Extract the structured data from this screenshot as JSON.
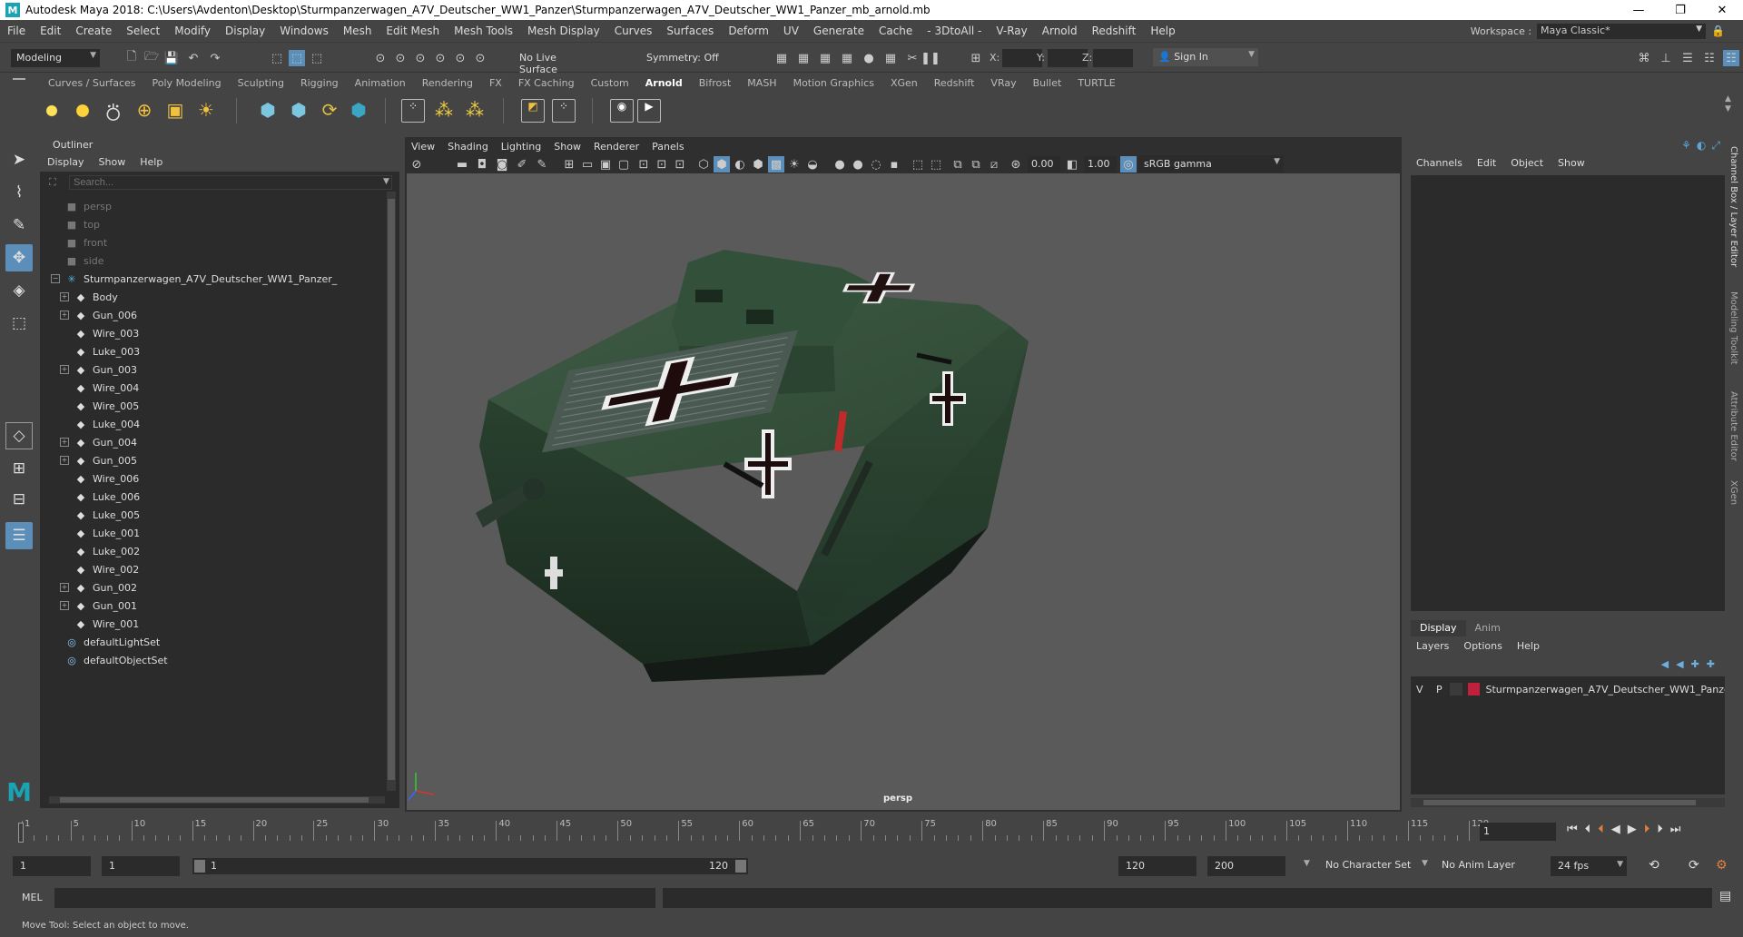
{
  "window": {
    "title": "Autodesk Maya 2018: C:\\Users\\Avdenton\\Desktop\\Sturmpanzerwagen_A7V_Deutscher_WW1_Panzer\\Sturmpanzerwagen_A7V_Deutscher_WW1_Panzer_mb_arnold.mb",
    "minimize": "—",
    "maximize": "❐",
    "close": "✕"
  },
  "menubar": {
    "items": [
      "File",
      "Edit",
      "Create",
      "Select",
      "Modify",
      "Display",
      "Windows",
      "Mesh",
      "Edit Mesh",
      "Mesh Tools",
      "Mesh Display",
      "Curves",
      "Surfaces",
      "Deform",
      "UV",
      "Generate",
      "Cache",
      "- 3DtoAll -",
      "V-Ray",
      "Arnold",
      "Redshift",
      "Help"
    ],
    "workspace_label": "Workspace :",
    "workspace_value": "Maya Classic*"
  },
  "statusline": {
    "mode": "Modeling",
    "live_surface": "No Live Surface",
    "symmetry": "Symmetry: Off",
    "x_label": "X:",
    "y_label": "Y:",
    "z_label": "Z:",
    "sign_in": "Sign In"
  },
  "shelf": {
    "tabs": [
      "Curves / Surfaces",
      "Poly Modeling",
      "Sculpting",
      "Rigging",
      "Animation",
      "Rendering",
      "FX",
      "FX Caching",
      "Custom",
      "Arnold",
      "Bifrost",
      "MASH",
      "Motion Graphics",
      "XGen",
      "Redshift",
      "VRay",
      "Bullet",
      "TURTLE"
    ],
    "active": "Arnold"
  },
  "outliner": {
    "title": "Outliner",
    "menu": [
      "Display",
      "Show",
      "Help"
    ],
    "search_placeholder": "Search...",
    "cameras": [
      "persp",
      "top",
      "front",
      "side"
    ],
    "root": "Sturmpanzerwagen_A7V_Deutscher_WW1_Panzer_",
    "children": [
      {
        "name": "Body",
        "expandable": true
      },
      {
        "name": "Gun_006",
        "expandable": true
      },
      {
        "name": "Wire_003",
        "expandable": false
      },
      {
        "name": "Luke_003",
        "expandable": false
      },
      {
        "name": "Gun_003",
        "expandable": true
      },
      {
        "name": "Wire_004",
        "expandable": false
      },
      {
        "name": "Wire_005",
        "expandable": false
      },
      {
        "name": "Luke_004",
        "expandable": false
      },
      {
        "name": "Gun_004",
        "expandable": true
      },
      {
        "name": "Gun_005",
        "expandable": true
      },
      {
        "name": "Wire_006",
        "expandable": false
      },
      {
        "name": "Luke_006",
        "expandable": false
      },
      {
        "name": "Luke_005",
        "expandable": false
      },
      {
        "name": "Luke_001",
        "expandable": false
      },
      {
        "name": "Luke_002",
        "expandable": false
      },
      {
        "name": "Wire_002",
        "expandable": false
      },
      {
        "name": "Gun_002",
        "expandable": true
      },
      {
        "name": "Gun_001",
        "expandable": true
      },
      {
        "name": "Wire_001",
        "expandable": false
      }
    ],
    "sets": [
      "defaultLightSet",
      "defaultObjectSet"
    ]
  },
  "viewport": {
    "menu": [
      "View",
      "Shading",
      "Lighting",
      "Show",
      "Renderer",
      "Panels"
    ],
    "exposure": "0.00",
    "gamma": "1.00",
    "colorspace": "sRGB gamma",
    "camera_label": "persp"
  },
  "channelbox": {
    "menu": [
      "Channels",
      "Edit",
      "Object",
      "Show"
    ]
  },
  "layereditor": {
    "tabs": [
      "Display",
      "Anim"
    ],
    "menu": [
      "Layers",
      "Options",
      "Help"
    ],
    "layer": {
      "v": "V",
      "p": "P",
      "name": "Sturmpanzerwagen_A7V_Deutscher_WW1_Panze",
      "color": "#c0203a"
    }
  },
  "side_tabs": [
    "Channel Box / Layer Editor",
    "Modeling Toolkit",
    "Attribute Editor",
    "XGen"
  ],
  "timeline": {
    "ticks": [
      "1",
      "5",
      "10",
      "15",
      "20",
      "25",
      "30",
      "35",
      "40",
      "45",
      "50",
      "55",
      "60",
      "65",
      "70",
      "75",
      "80",
      "85",
      "90",
      "95",
      "100",
      "105",
      "110",
      "115",
      "120"
    ],
    "current_frame": "1"
  },
  "range": {
    "start": "1",
    "playback_start": "1",
    "slider_start": "1",
    "slider_end": "120",
    "playback_end": "120",
    "end": "200",
    "character_set": "No Character Set",
    "anim_layer": "No Anim Layer",
    "fps": "24 fps"
  },
  "cmdline": {
    "label": "MEL"
  },
  "helpline": {
    "text": "Move Tool: Select an object to move."
  }
}
